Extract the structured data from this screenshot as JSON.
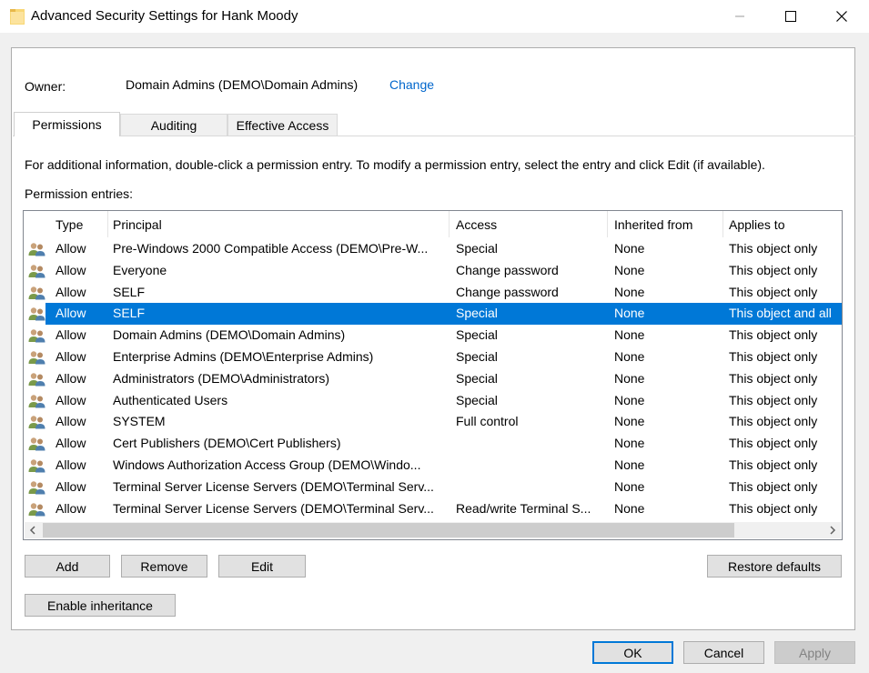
{
  "window": {
    "title": "Advanced Security Settings for Hank Moody",
    "controls": {
      "minimize": "—",
      "maximize": "☐",
      "close": "✕"
    }
  },
  "owner": {
    "label": "Owner:",
    "value": "Domain Admins (DEMO\\Domain Admins)",
    "change_link": "Change"
  },
  "tabs": [
    {
      "label": "Permissions",
      "active": true
    },
    {
      "label": "Auditing",
      "active": false
    },
    {
      "label": "Effective Access",
      "active": false
    }
  ],
  "info_text": "For additional information, double-click a permission entry. To modify a permission entry, select the entry and click Edit (if available).",
  "entries_label": "Permission entries:",
  "table": {
    "columns": [
      "Type",
      "Principal",
      "Access",
      "Inherited from",
      "Applies to"
    ],
    "rows": [
      {
        "type": "Allow",
        "principal": "Pre-Windows 2000 Compatible Access (DEMO\\Pre-W...",
        "access": "Special",
        "inherited": "None",
        "applies": "This object only"
      },
      {
        "type": "Allow",
        "principal": "Everyone",
        "access": "Change password",
        "inherited": "None",
        "applies": "This object only"
      },
      {
        "type": "Allow",
        "principal": "SELF",
        "access": "Change password",
        "inherited": "None",
        "applies": "This object only"
      },
      {
        "type": "Allow",
        "principal": "SELF",
        "access": "Special",
        "inherited": "None",
        "applies": "This object and all",
        "selected": true
      },
      {
        "type": "Allow",
        "principal": "Domain Admins (DEMO\\Domain Admins)",
        "access": "Special",
        "inherited": "None",
        "applies": "This object only"
      },
      {
        "type": "Allow",
        "principal": "Enterprise Admins (DEMO\\Enterprise Admins)",
        "access": "Special",
        "inherited": "None",
        "applies": "This object only"
      },
      {
        "type": "Allow",
        "principal": "Administrators (DEMO\\Administrators)",
        "access": "Special",
        "inherited": "None",
        "applies": "This object only"
      },
      {
        "type": "Allow",
        "principal": "Authenticated Users",
        "access": "Special",
        "inherited": "None",
        "applies": "This object only"
      },
      {
        "type": "Allow",
        "principal": "SYSTEM",
        "access": "Full control",
        "inherited": "None",
        "applies": "This object only"
      },
      {
        "type": "Allow",
        "principal": "Cert Publishers (DEMO\\Cert Publishers)",
        "access": "",
        "inherited": "None",
        "applies": "This object only"
      },
      {
        "type": "Allow",
        "principal": "Windows Authorization Access Group (DEMO\\Windo...",
        "access": "",
        "inherited": "None",
        "applies": "This object only"
      },
      {
        "type": "Allow",
        "principal": "Terminal Server License Servers (DEMO\\Terminal Serv...",
        "access": "",
        "inherited": "None",
        "applies": "This object only"
      },
      {
        "type": "Allow",
        "principal": "Terminal Server License Servers (DEMO\\Terminal Serv...",
        "access": "Read/write Terminal S...",
        "inherited": "None",
        "applies": "This object only"
      }
    ]
  },
  "scrollbar": {
    "left_arrow": "<",
    "right_arrow": ">"
  },
  "buttons": {
    "add": "Add",
    "remove": "Remove",
    "edit": "Edit",
    "restore_defaults": "Restore defaults",
    "enable_inheritance": "Enable inheritance",
    "ok": "OK",
    "cancel": "Cancel",
    "apply": "Apply"
  },
  "colors": {
    "selection": "#0078d7",
    "link": "#0066cc",
    "folder_icon": "#f8d775"
  },
  "icons": {
    "row_icon": "users-group-icon",
    "title_icon": "folder-icon"
  }
}
